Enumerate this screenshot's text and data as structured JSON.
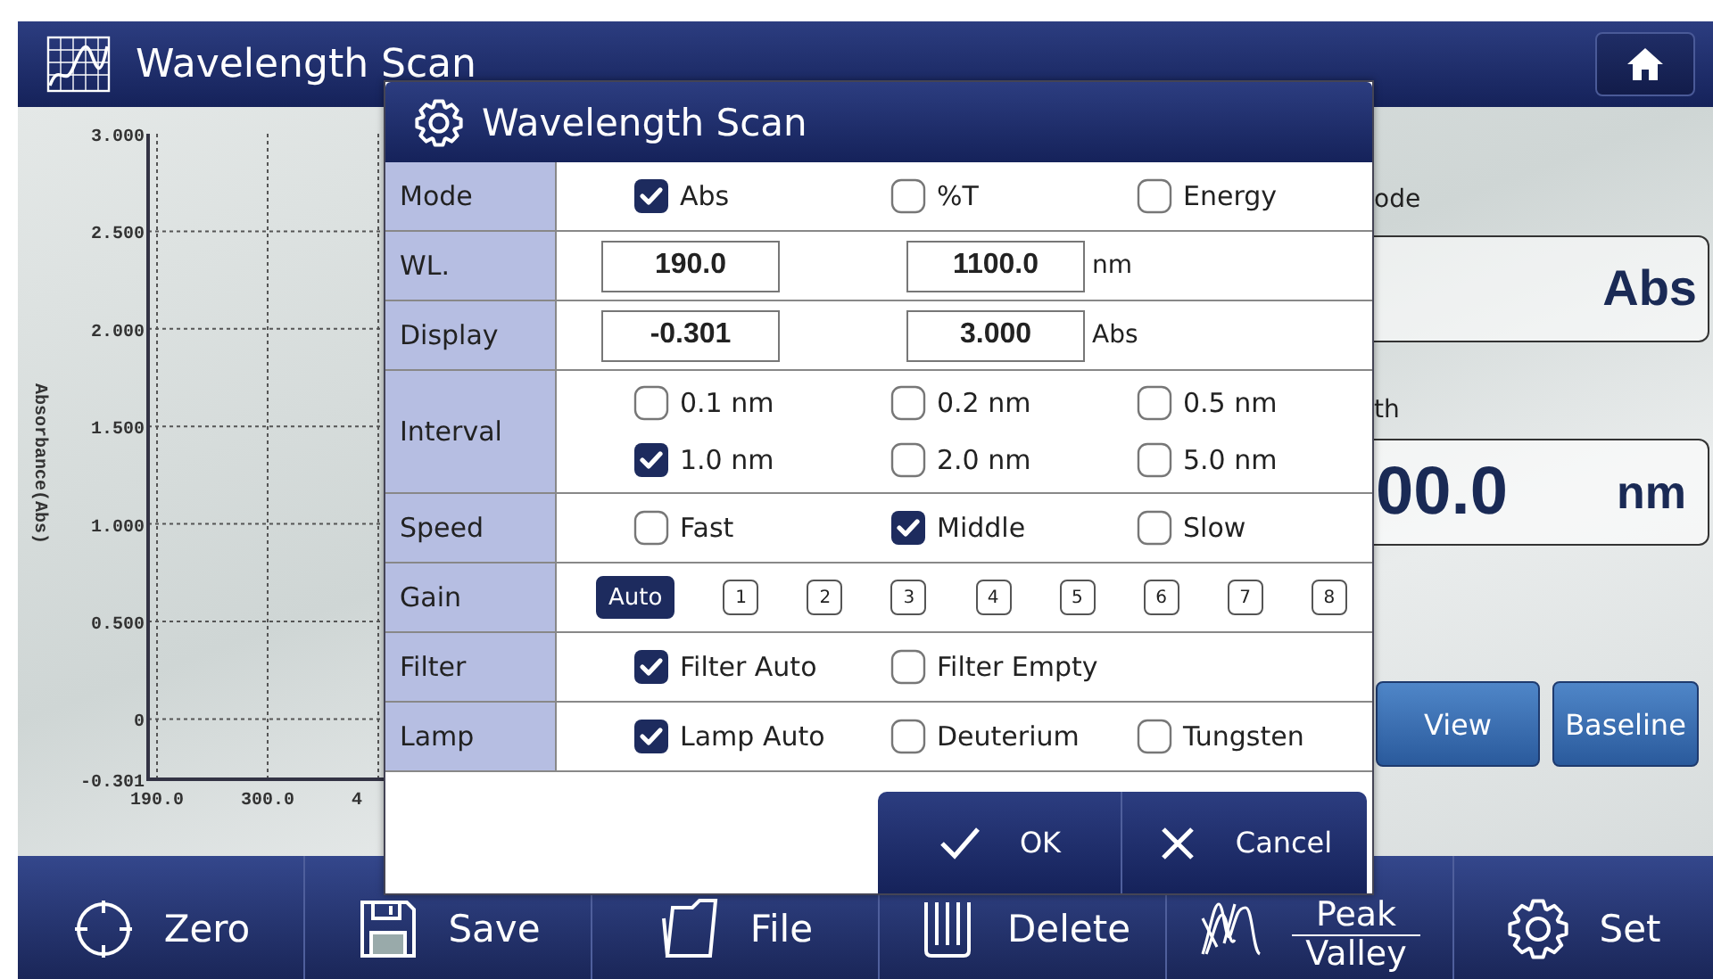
{
  "header": {
    "title": "Wavelength Scan"
  },
  "chart": {
    "axis_title": "Absorbance(Abs)",
    "y_ticks": [
      "3.000",
      "2.500",
      "2.000",
      "1.500",
      "1.000",
      "0.500",
      "0",
      "-0.301"
    ],
    "x_ticks": [
      "190.0",
      "300.0",
      "4"
    ]
  },
  "side_panel": {
    "mode_label": "ode",
    "mode_value": "Abs",
    "wavelength_label": "th",
    "wavelength_value": "00.0",
    "wavelength_unit": "nm",
    "buttons": [
      "View",
      "Baseline"
    ]
  },
  "toolbar": [
    {
      "kind": "plain",
      "label": "Zero"
    },
    {
      "kind": "plain",
      "label": "Save"
    },
    {
      "kind": "plain",
      "label": "File"
    },
    {
      "kind": "plain",
      "label": "Delete"
    },
    {
      "kind": "stacked",
      "labels": [
        "Peak",
        "Valley"
      ]
    },
    {
      "kind": "plain",
      "label": "Set"
    }
  ],
  "dialog": {
    "title": "Wavelength Scan",
    "rows": [
      {
        "label": "Mode",
        "kind": "options",
        "options": [
          {
            "label": "Abs",
            "checked": true
          },
          {
            "label": "%T",
            "checked": false
          },
          {
            "label": "Energy",
            "checked": false
          }
        ]
      },
      {
        "label": "WL.",
        "kind": "range",
        "values": [
          "190.0",
          "1100.0"
        ],
        "unit": "nm"
      },
      {
        "label": "Display",
        "kind": "range",
        "values": [
          "-0.301",
          "3.000"
        ],
        "unit": "Abs"
      },
      {
        "label": "Interval",
        "kind": "options",
        "options": [
          {
            "label": "0.1 nm",
            "checked": false
          },
          {
            "label": "0.2 nm",
            "checked": false
          },
          {
            "label": "0.5 nm",
            "checked": false
          },
          {
            "label": "1.0 nm",
            "checked": true
          },
          {
            "label": "2.0 nm",
            "checked": false
          },
          {
            "label": "5.0 nm",
            "checked": false
          }
        ]
      },
      {
        "label": "Speed",
        "kind": "options",
        "options": [
          {
            "label": "Fast",
            "checked": false
          },
          {
            "label": "Middle",
            "checked": true
          },
          {
            "label": "Slow",
            "checked": false
          }
        ]
      },
      {
        "label": "Gain",
        "kind": "gain",
        "choices": [
          {
            "label": "Auto",
            "selected": true
          },
          {
            "label": "1",
            "selected": false
          },
          {
            "label": "2",
            "selected": false
          },
          {
            "label": "3",
            "selected": false
          },
          {
            "label": "4",
            "selected": false
          },
          {
            "label": "5",
            "selected": false
          },
          {
            "label": "6",
            "selected": false
          },
          {
            "label": "7",
            "selected": false
          },
          {
            "label": "8",
            "selected": false
          }
        ]
      },
      {
        "label": "Filter",
        "kind": "options",
        "options": [
          {
            "label": "Filter Auto",
            "checked": true
          },
          {
            "label": "Filter Empty",
            "checked": false
          }
        ]
      },
      {
        "label": "Lamp",
        "kind": "options",
        "options": [
          {
            "label": "Lamp Auto",
            "checked": true
          },
          {
            "label": "Deuterium",
            "checked": false
          },
          {
            "label": "Tungsten",
            "checked": false
          }
        ]
      }
    ],
    "buttons": [
      "OK",
      "Cancel"
    ]
  }
}
